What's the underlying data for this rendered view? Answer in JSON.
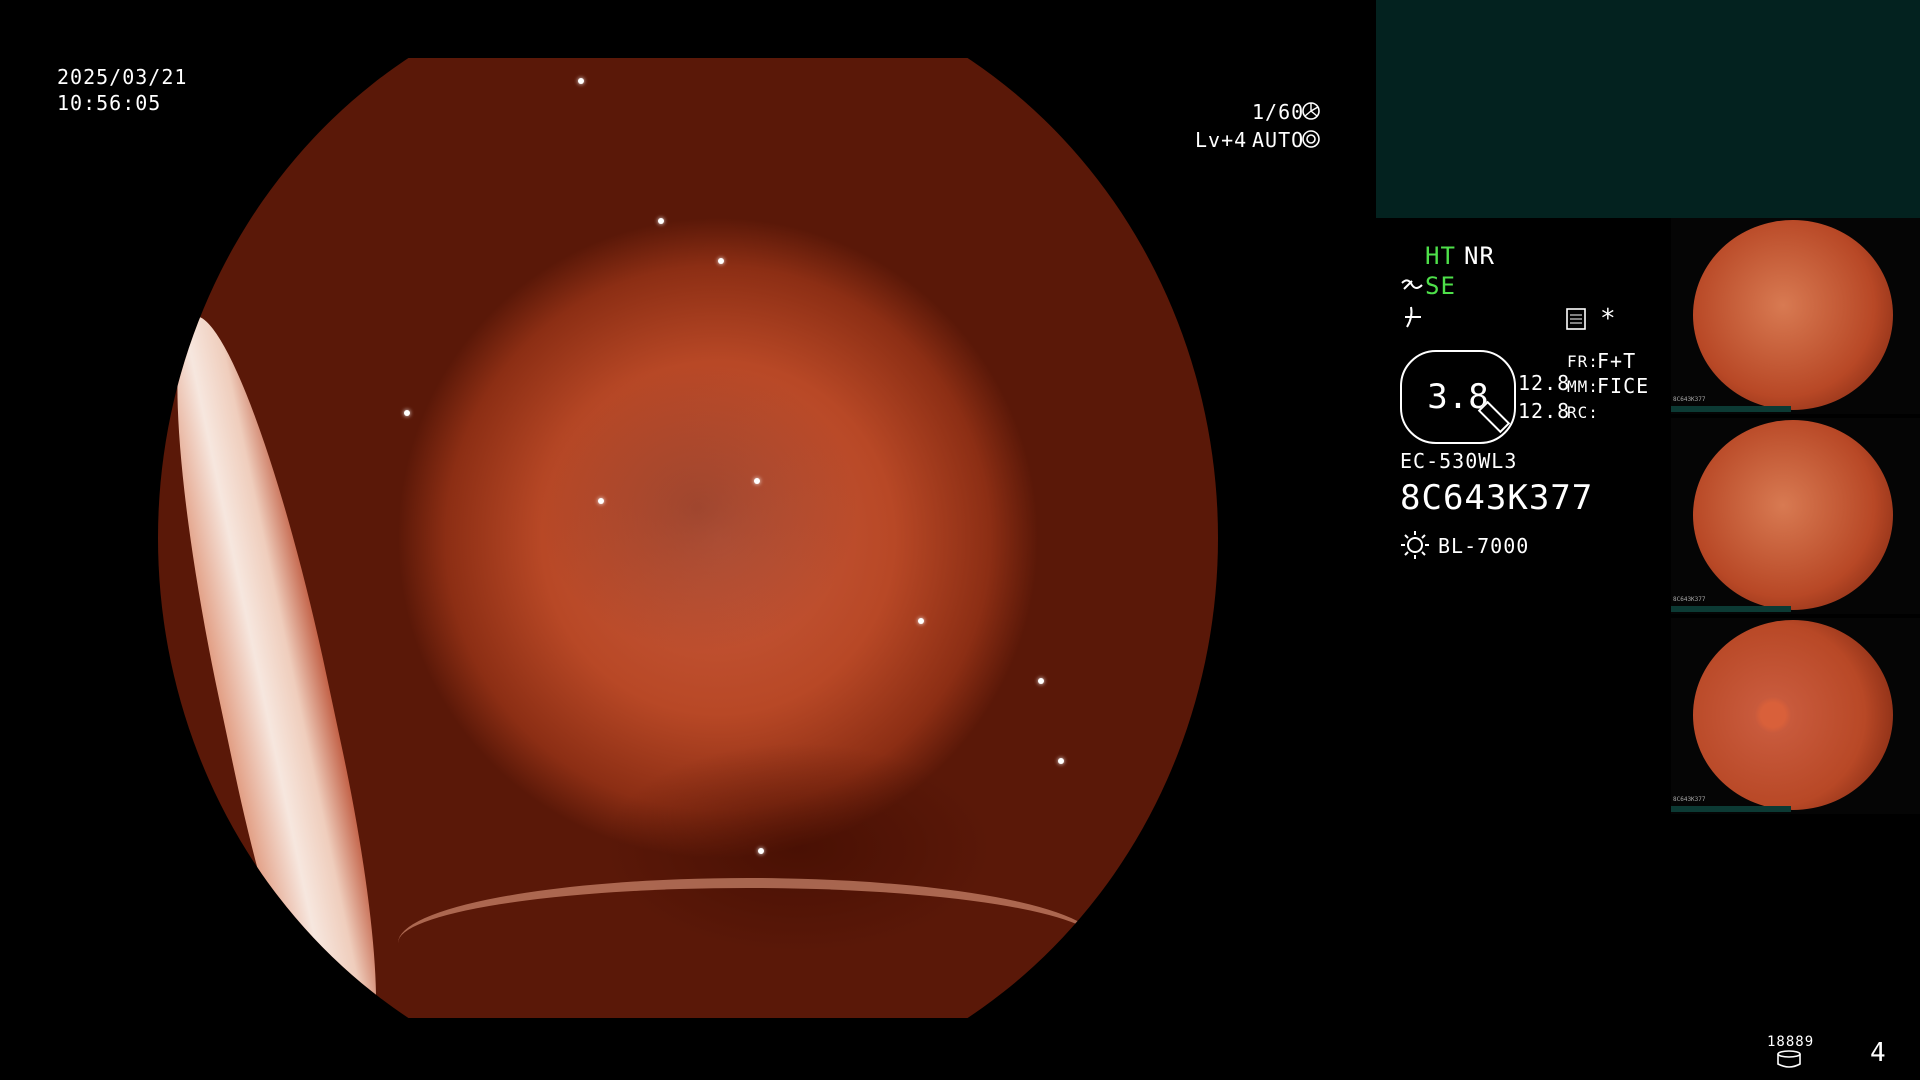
{
  "datetime": {
    "date": "2025/03/21",
    "time": "10:56:05"
  },
  "shutter": {
    "speed": "1/60",
    "level": "Lv+4",
    "mode": "AUTO"
  },
  "enhancements": {
    "ht": "HT",
    "nr": "NR",
    "se": "SE"
  },
  "side_info": {
    "asterisk": "*",
    "depth_value": "3.8",
    "value_a": "12.8",
    "value_b": "12.8",
    "fr_label": "FR:",
    "fr_value": "F+T",
    "mm_label": "MM:",
    "mm_value": "FICE",
    "rc_label": "RC:",
    "scope_model": "EC-530WL3",
    "serial": "8C643K377",
    "light_source": "BL-7000"
  },
  "thumbnails": [
    {
      "serial": "8C643K377"
    },
    {
      "serial": "8C643K377"
    },
    {
      "serial": "8C643K377"
    }
  ],
  "footer": {
    "storage_count": "18889",
    "frame_number": "4"
  },
  "colors": {
    "accent_green": "#4ee04a",
    "panel_dark": "#03221f",
    "tissue": "#b84826"
  }
}
